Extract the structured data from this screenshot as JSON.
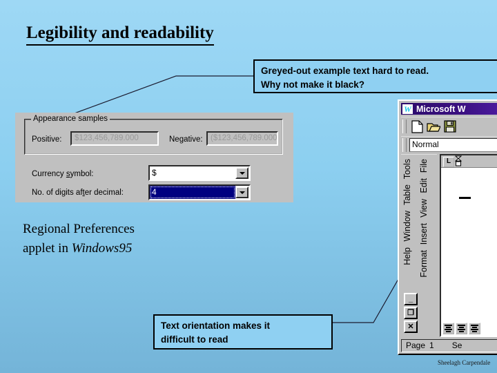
{
  "slide": {
    "title": "Legibility and readability",
    "background_top": "#9ED8F5",
    "background_bottom": "#74B4D8",
    "footer_credit": "Sheelagh Carpendale"
  },
  "callouts": {
    "greyed_out": {
      "line1": "Greyed-out example text hard to read.",
      "line2": "Why not make it black?"
    },
    "orientation": {
      "line1": "Text orientation makes it",
      "line2": "difficult to read"
    }
  },
  "caption": {
    "line1": "Regional Preferences",
    "line2_prefix": "applet in ",
    "line2_italic": "Windows95"
  },
  "dialog": {
    "groupbox_label": "Appearance samples",
    "positive_label": "Positive:",
    "positive_value": "$123,456,789.000",
    "negative_label": "Negative:",
    "negative_value": "($123,456,789.000",
    "currency_symbol_label_a": "Currency ",
    "currency_symbol_label_u": "s",
    "currency_symbol_label_b": "ymbol:",
    "currency_symbol_value": "$",
    "digits_label_a": "No. of digits af",
    "digits_label_u": "t",
    "digits_label_b": "er decimal:",
    "digits_value": "4",
    "face_color": "#C0C0C0",
    "greyed_text_color": "#9a9a9a",
    "selection_color": "#000080"
  },
  "word": {
    "title": "Microsoft W",
    "logo_letter": "W",
    "toolbar_icons": [
      "new-document-icon",
      "open-folder-icon",
      "save-disk-icon"
    ],
    "style_value": "Normal",
    "menu_column_left": [
      "Tools",
      "Table",
      "Window",
      "Help"
    ],
    "menu_column_right": [
      "File",
      "Edit",
      "View",
      "Insert",
      "Format"
    ],
    "window_buttons": [
      "_",
      "❐",
      "✕"
    ],
    "tab_marker": "L",
    "status_page_label": "Page",
    "status_page_number": "1",
    "status_sec_label": "Se",
    "titlebar_color": "#2B0B6B"
  }
}
